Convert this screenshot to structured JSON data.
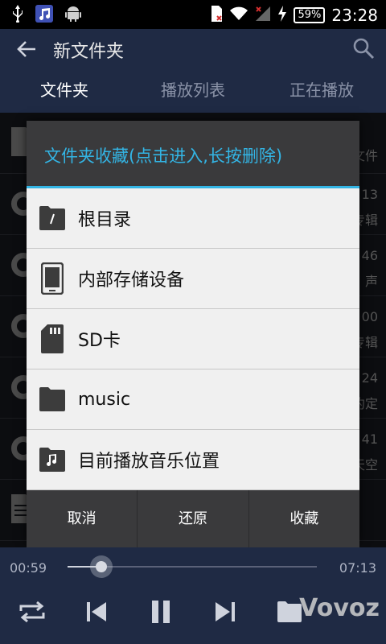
{
  "status_bar": {
    "battery": "59%",
    "time": "23:28"
  },
  "app_bar": {
    "title": "新文件夹"
  },
  "tabs": [
    {
      "label": "文件夹",
      "active": true
    },
    {
      "label": "播放列表",
      "active": false
    },
    {
      "label": "正在播放",
      "active": false
    }
  ],
  "background_list": {
    "right_snippets": [
      "文件",
      "13",
      "专辑",
      "46",
      "声",
      "00",
      "专辑",
      "24",
      "约定",
      "41",
      "天空"
    ]
  },
  "dialog": {
    "title": "文件夹收藏(点击进入,长按删除)",
    "items": [
      {
        "label": "根目录",
        "icon": "root-folder-icon"
      },
      {
        "label": "内部存储设备",
        "icon": "phone-storage-icon"
      },
      {
        "label": "SD卡",
        "icon": "sd-card-icon"
      },
      {
        "label": "music",
        "icon": "folder-icon"
      },
      {
        "label": "目前播放音乐位置",
        "icon": "music-folder-icon"
      }
    ],
    "buttons": {
      "cancel": "取消",
      "restore": "还原",
      "favorite": "收藏"
    }
  },
  "player": {
    "elapsed": "00:59",
    "duration": "07:13",
    "progress_fraction": 0.135
  },
  "watermark": "Vovoz",
  "colors": {
    "accent": "#33b5e5",
    "bar_bg": "#1f2a44",
    "dialog_bg": "#3a3a3c"
  }
}
